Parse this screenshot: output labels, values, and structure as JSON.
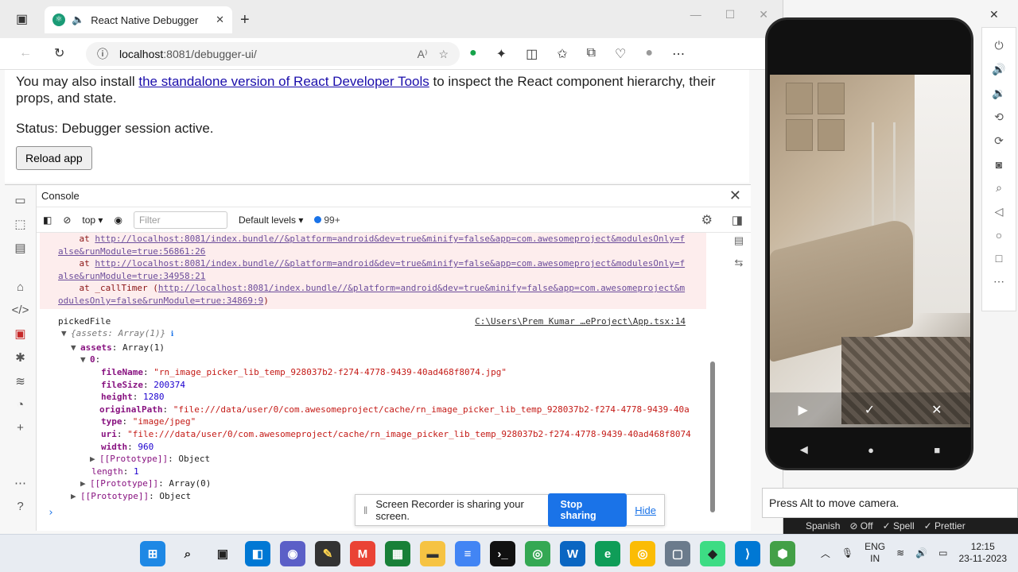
{
  "browser": {
    "tab_title": "React Native Debugger",
    "address_host": "localhost",
    "address_rest": ":8081/debugger-ui/"
  },
  "page": {
    "intro_before": "You may also install ",
    "intro_link": "the standalone version of React Developer Tools",
    "intro_after": " to inspect the React component hierarchy, their props, and state.",
    "status": "Status: Debugger session active.",
    "reload_label": "Reload app"
  },
  "devtools": {
    "panel_title": "Console",
    "context": "top",
    "filter_placeholder": "Filter",
    "levels": "Default levels",
    "issues_count": "99+"
  },
  "console": {
    "error_lines": [
      {
        "prefix": "    at ",
        "link": "http://localhost:8081/index.bundle//&platform=android&dev=true&minify=false&app=com.awesomeproject&modulesOnly=f",
        "suffix": ""
      },
      {
        "prefix": "",
        "link": "alse&runModule=true:56861:26",
        "suffix": ""
      },
      {
        "prefix": "    at ",
        "link": "http://localhost:8081/index.bundle//&platform=android&dev=true&minify=false&app=com.awesomeproject&modulesOnly=f",
        "suffix": ""
      },
      {
        "prefix": "",
        "link": "alse&runModule=true:34958:21",
        "suffix": ""
      },
      {
        "prefix": "    at _callTimer (",
        "link": "http://localhost:8081/index.bundle//&platform=android&dev=true&minify=false&app=com.awesomeproject&m",
        "suffix": ""
      },
      {
        "prefix": "",
        "link": "odulesOnly=false&runModule=true:34869:9",
        "suffix": ")"
      }
    ],
    "log_label": "pickedFile",
    "log_source": "C:\\Users\\Prem Kumar …eProject\\App.tsx:14",
    "obj_summary": "{assets: Array(1)}",
    "assets_key": "assets",
    "assets_val": "Array(1)",
    "index_key": "0",
    "fields": [
      {
        "key": "fileName",
        "value": "\"rn_image_picker_lib_temp_928037b2-f274-4778-9439-40ad468f8074.jpg\"",
        "type": "s"
      },
      {
        "key": "fileSize",
        "value": "200374",
        "type": "n"
      },
      {
        "key": "height",
        "value": "1280",
        "type": "n"
      },
      {
        "key": "originalPath",
        "value": "\"file:///data/user/0/com.awesomeproject/cache/rn_image_picker_lib_temp_928037b2-f274-4778-9439-40a",
        "type": "s"
      },
      {
        "key": "type",
        "value": "\"image/jpeg\"",
        "type": "s"
      },
      {
        "key": "uri",
        "value": "\"file:///data/user/0/com.awesomeproject/cache/rn_image_picker_lib_temp_928037b2-f274-4778-9439-40ad468f8074",
        "type": "s"
      },
      {
        "key": "width",
        "value": "960",
        "type": "n"
      }
    ],
    "proto_inner": "[[Prototype]]",
    "proto_inner_val": "Object",
    "length_key": "length",
    "length_val": "1",
    "proto_array": "[[Prototype]]",
    "proto_array_val": "Array(0)",
    "proto_outer": "[[Prototype]]",
    "proto_outer_val": "Object"
  },
  "share": {
    "message": "Screen Recorder is sharing your screen.",
    "stop_label": "Stop sharing",
    "hide_label": "Hide"
  },
  "emulator": {
    "tooltip": "Press Alt to move camera."
  },
  "vscode_status": {
    "language": "Spanish",
    "off": "Off",
    "spell": "Spell",
    "prettier": "Prettier"
  },
  "taskbar": {
    "lang_top": "ENG",
    "lang_bottom": "IN",
    "time": "12:15",
    "date": "23-11-2023"
  }
}
